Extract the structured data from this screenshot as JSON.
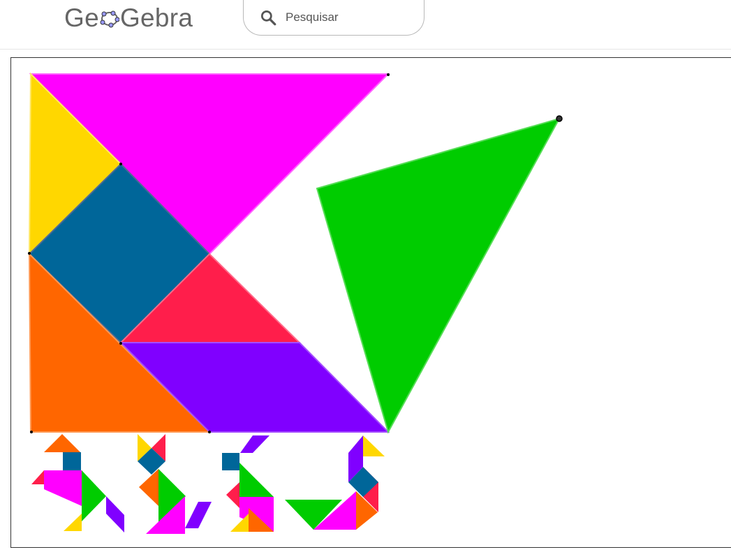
{
  "header": {
    "logo_text_before": "Ge",
    "logo_text_after": "Gebra",
    "logo_color": "#666666"
  },
  "search": {
    "placeholder": "Pesquisar",
    "icon": "search-icon"
  },
  "applet": {
    "pieces": {
      "large_triangle_1_color": "#FF00FF",
      "large_triangle_2_color": "#FF6600",
      "medium_triangle_color": "#00CC00",
      "small_triangle_1_color": "#FFD700",
      "small_triangle_2_color": "#FF1E4B",
      "square_color": "#006699",
      "parallelogram_color": "#8000FF"
    },
    "figures": [
      "figure-1",
      "figure-2",
      "figure-3",
      "figure-4"
    ]
  }
}
